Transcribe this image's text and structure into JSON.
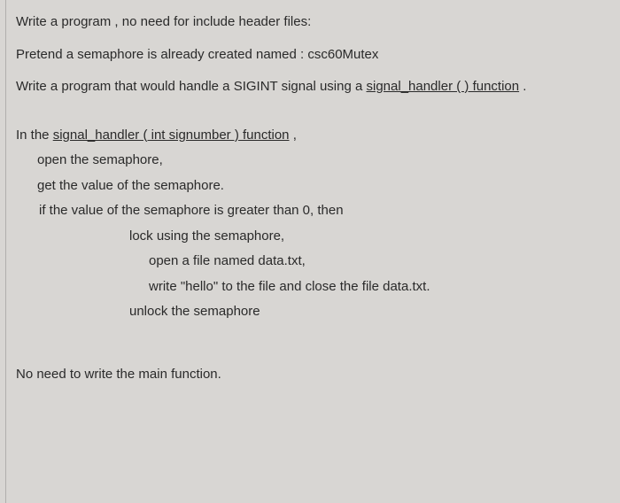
{
  "intro": {
    "line1": "Write a program , no need for include header files:",
    "line2": "Pretend a semaphore is already created named : csc60Mutex",
    "line3_pre": "Write a program that would handle a SIGINT signal using a ",
    "line3_underline": "signal_handler ( ) function",
    "line3_post": " ."
  },
  "body": {
    "fn_pre": "In the ",
    "fn_underline": "signal_handler ( int signumber )  function",
    "fn_post": " ,",
    "open_sem": "open the semaphore,",
    "get_val": "get the value of the semaphore.",
    "if_line": "if the value of the semaphore is greater than 0,   then",
    "lock": "lock using the semaphore,",
    "open_file": "open a file named data.txt,",
    "write_file": "write \"hello\" to the file and close the file data.txt.",
    "unlock": "unlock the semaphore"
  },
  "footer": {
    "note": "No need to write the main function."
  }
}
